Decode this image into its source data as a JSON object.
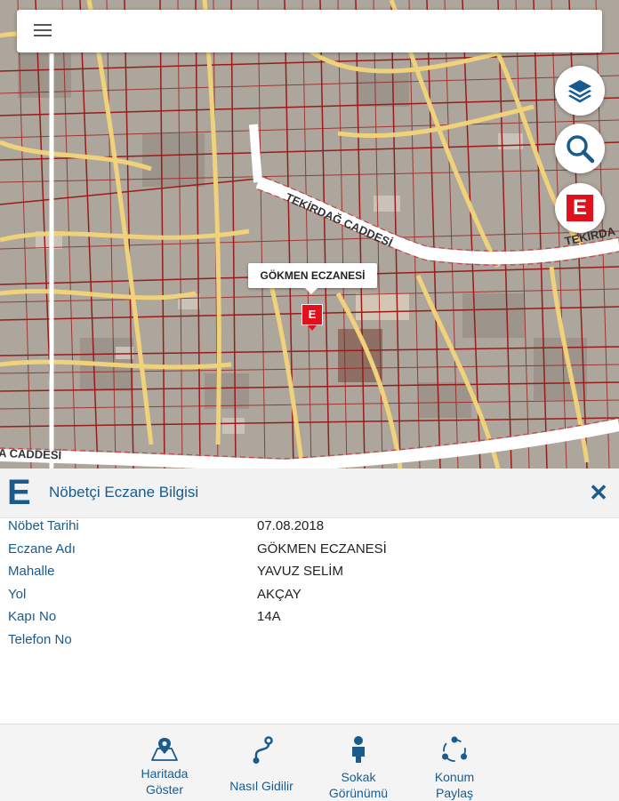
{
  "map": {
    "street_labels": [
      "TEKİRDAĞ CADDESİ",
      "TEKİRDA",
      "A CADDESİ"
    ],
    "pharmacy_label": "GÖKMEN ECZANESİ",
    "marker_letter": "E"
  },
  "search_bar": {
    "menu_icon": "hamburger-menu-icon"
  },
  "map_controls": [
    {
      "name": "layers",
      "icon": "layers-icon"
    },
    {
      "name": "search",
      "icon": "search-icon"
    },
    {
      "name": "pharmacy",
      "icon": "pharmacy-e-icon",
      "letter": "E"
    }
  ],
  "info_panel": {
    "logo_letter": "E",
    "title": "Nöbetçi Eczane Bilgisi",
    "close_icon": "close-icon",
    "rows": [
      {
        "label": "Nöbet Tarihi",
        "value": "07.08.2018"
      },
      {
        "label": "Eczane Adı",
        "value": "GÖKMEN ECZANESİ"
      },
      {
        "label": "Mahalle",
        "value": "YAVUZ SELİM"
      },
      {
        "label": "Yol",
        "value": "AKÇAY"
      },
      {
        "label": "Kapı No",
        "value": "14A"
      },
      {
        "label": "Telefon No",
        "value": ""
      }
    ]
  },
  "bottom_nav": {
    "show_on_map": {
      "line1": "Haritada",
      "line2": "Göster",
      "icon": "map-pin-icon"
    },
    "directions": {
      "line1": "Nasıl Gidilir",
      "icon": "route-icon"
    },
    "street_view": {
      "line1": "Sokak",
      "line2": "Görünümü",
      "icon": "pegman-icon"
    },
    "share_location": {
      "line1": "Konum",
      "line2": "Paylaş",
      "icon": "share-icon"
    }
  },
  "colors": {
    "accent": "#1a5b8e",
    "marker_red": "#e0101c",
    "parcel_lines": "#9b1b1b",
    "road_yellow": "#f0d27a"
  }
}
